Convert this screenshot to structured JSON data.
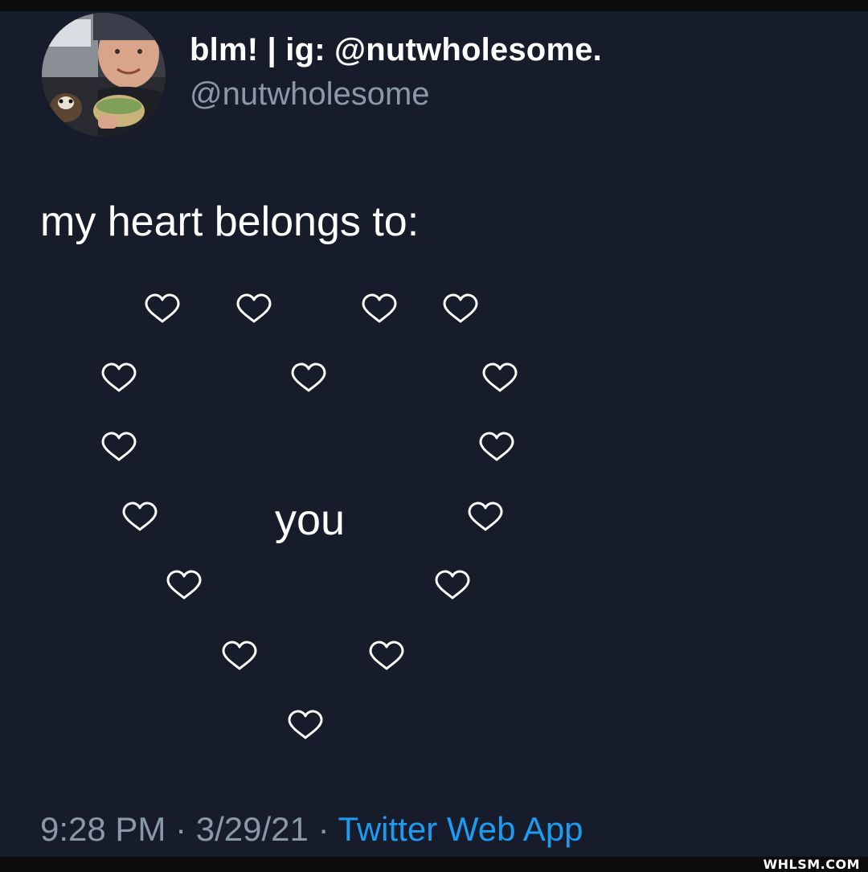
{
  "user": {
    "display_name": "blm! | ig: @nutwholesome.",
    "handle": "@nutwholesome"
  },
  "tweet": {
    "text": "my heart belongs to:",
    "center_word": "you",
    "heart_glyph": "white-heart-outline-icon"
  },
  "meta": {
    "time": "9:28 PM",
    "separator": "·",
    "date": "3/29/21",
    "source": "Twitter Web App"
  },
  "watermark": "WHLSM.COM",
  "colors": {
    "background": "#161c2a",
    "text": "#ffffff",
    "muted": "#8b98a5",
    "link": "#1d9bf0"
  }
}
